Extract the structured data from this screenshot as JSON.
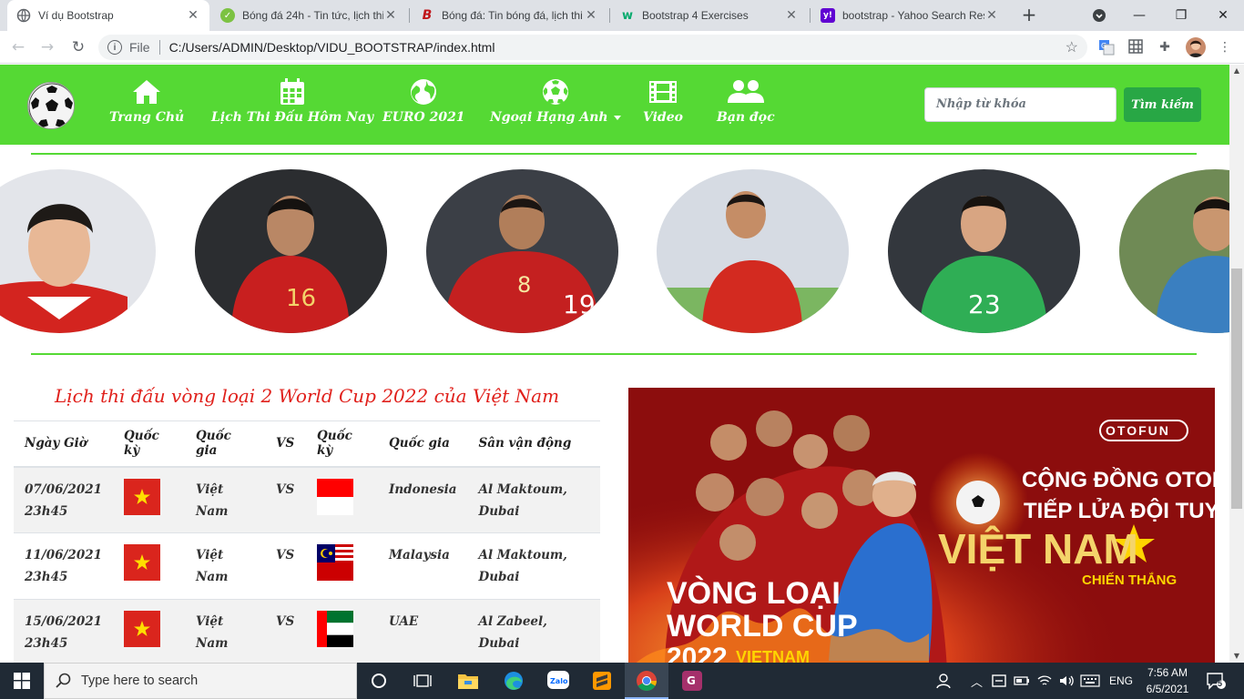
{
  "browser": {
    "tabs": [
      {
        "title": "Ví dụ Bootstrap",
        "active": true,
        "favicon": "globe-icon"
      },
      {
        "title": "Bóng đá 24h - Tin tức, lịch thi",
        "active": false,
        "favicon": "bongda24h-icon"
      },
      {
        "title": "Bóng đá: Tin bóng đá, lịch thi",
        "active": false,
        "favicon": "bongda-b-icon"
      },
      {
        "title": "Bootstrap 4 Exercises",
        "active": false,
        "favicon": "w3-icon"
      },
      {
        "title": "bootstrap - Yahoo Search Resu",
        "active": false,
        "favicon": "yahoo-icon"
      }
    ],
    "address": {
      "scheme_label": "File",
      "url": "C:/Users/ADMIN/Desktop/VIDU_BOOTSTRAP/index.html"
    }
  },
  "site": {
    "nav": {
      "items": [
        {
          "label": "Trang Chủ",
          "icon": "home-icon"
        },
        {
          "label": "Lịch Thi Đấu Hôm Nay",
          "icon": "calendar-icon"
        },
        {
          "label": "EURO 2021",
          "icon": "globe-icon"
        },
        {
          "label": "Ngoại Hạng Anh",
          "icon": "soccer-ball-icon",
          "dropdown": true
        },
        {
          "label": "Video",
          "icon": "film-icon"
        },
        {
          "label": "Bạn đọc",
          "icon": "users-icon"
        }
      ],
      "search_placeholder": "Nhập từ khóa",
      "search_button": "Tìm kiếm"
    },
    "players": [
      {
        "jersey": "",
        "shirt_color": "#d3241f"
      },
      {
        "jersey": "16",
        "shirt_color": "#c81f1f"
      },
      {
        "jersey": "8",
        "shirt_color": "#c42020"
      },
      {
        "jersey": "",
        "shirt_color": "#d32a20"
      },
      {
        "jersey": "23",
        "shirt_color": "#2fae55"
      },
      {
        "jersey": "",
        "shirt_color": "#3a7fc0"
      }
    ],
    "schedule": {
      "title": "Lịch thi đấu vòng loại 2 World Cup 2022 của Việt Nam",
      "headers": [
        "Ngày Giờ",
        "Quốc kỳ",
        "Quốc gia",
        "VS",
        "Quốc kỳ",
        "Quốc gia",
        "Sân vận động"
      ],
      "rows": [
        {
          "date": "07/06/2021",
          "time": "23h45",
          "home": "Việt Nam",
          "vs": "VS",
          "away": "Indonesia",
          "away_flag": "indonesia",
          "stadium": "Al Maktoum, Dubai"
        },
        {
          "date": "11/06/2021",
          "time": "23h45",
          "home": "Việt Nam",
          "vs": "VS",
          "away": "Malaysia",
          "away_flag": "malaysia",
          "stadium": "Al Maktoum, Dubai"
        },
        {
          "date": "15/06/2021",
          "time": "23h45",
          "home": "Việt Nam",
          "vs": "VS",
          "away": "UAE",
          "away_flag": "uae",
          "stadium": "Al Zabeel, Dubai"
        }
      ]
    },
    "banner": {
      "brand": "OTOFUN",
      "line1": "CỘNG ĐỒNG OTOFUN",
      "line2": "TIẾP LỬA ĐỘI TUYỂN",
      "line3": "VIỆT NAM",
      "line4": "CHIẾN THẮNG",
      "line5": "VÒNG LOẠI",
      "line6": "WORLD CUP",
      "line7": "2022",
      "line8": "VIETNAM"
    },
    "colors": {
      "nav_green": "#55d934",
      "title_red": "#e0201b",
      "button_green": "#28a745"
    }
  },
  "taskbar": {
    "search_placeholder": "Type here to search",
    "language": "ENG",
    "time": "7:56 AM",
    "date": "6/5/2021",
    "notifications": "5"
  }
}
